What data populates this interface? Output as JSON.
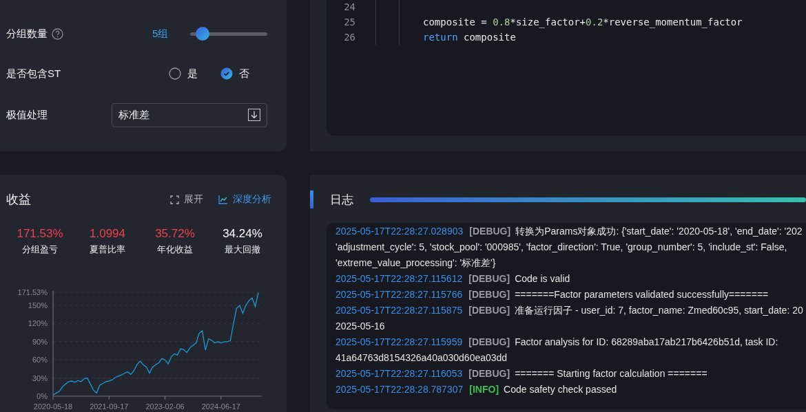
{
  "settings": {
    "group_count": {
      "label": "分组数量",
      "value": "5组",
      "level": 0.1
    },
    "include_st": {
      "label": "是否包含ST",
      "options": [
        {
          "label": "是",
          "selected": false
        },
        {
          "label": "否",
          "selected": true
        }
      ]
    },
    "extreme_value": {
      "label": "极值处理",
      "value": "标准差"
    }
  },
  "code": {
    "lines": [
      {
        "number": "24"
      },
      {
        "number": "25",
        "tokens": [
          {
            "text": "composite = ",
            "kind": "plain"
          },
          {
            "text": "0.8",
            "kind": "number"
          },
          {
            "text": "*size_factor+",
            "kind": "plain"
          },
          {
            "text": "0.2",
            "kind": "number"
          },
          {
            "text": "*reverse_momentum_factor",
            "kind": "plain"
          }
        ]
      },
      {
        "number": "26",
        "tokens": [
          {
            "text": "return",
            "kind": "keyword"
          },
          {
            "text": " composite",
            "kind": "plain"
          }
        ]
      }
    ]
  },
  "returns": {
    "title": "收益",
    "actions": [
      {
        "label": "展开",
        "kind": "expand"
      },
      {
        "label": "深度分析",
        "kind": "analysis"
      }
    ],
    "metrics": [
      {
        "value": "171.53%",
        "label": "分组盈亏",
        "color": "#f0424c"
      },
      {
        "value": "1.0994",
        "label": "夏普比率",
        "color": "#f0424c"
      },
      {
        "value": "35.72%",
        "label": "年化收益",
        "color": "#f0424c"
      },
      {
        "value": "34.24%",
        "label": "最大回撤",
        "color": "#ffffff"
      }
    ],
    "chart_data": {
      "type": "line",
      "grid": true,
      "categories": [
        "2020-05-18",
        null,
        null,
        null,
        null,
        null,
        null,
        null,
        null,
        null,
        null,
        null,
        null,
        null,
        null,
        null,
        null,
        null,
        "2021-09-17",
        null,
        null,
        null,
        null,
        null,
        null,
        null,
        null,
        null,
        null,
        null,
        null,
        null,
        null,
        null,
        null,
        null,
        "2023-02-06",
        null,
        null,
        null,
        null,
        null,
        null,
        null,
        null,
        null,
        null,
        null,
        null,
        null,
        null,
        null,
        null,
        null,
        "2024-06-17",
        null,
        null,
        null,
        null,
        null,
        null,
        null,
        null,
        null,
        null,
        null,
        null
      ],
      "ylim": [
        0,
        171.53
      ],
      "yticks": [
        {
          "value": 0,
          "label": "0%"
        },
        {
          "value": 30,
          "label": "30%"
        },
        {
          "value": 60,
          "label": "60%"
        },
        {
          "value": 90,
          "label": "90%"
        },
        {
          "value": 120,
          "label": "120%"
        },
        {
          "value": 150,
          "label": "150%"
        },
        {
          "value": 171.53,
          "label": "171.53%"
        }
      ],
      "series": [
        {
          "color": "#1a9ad6",
          "values": [
            2,
            5,
            8,
            15,
            20,
            24,
            25,
            23,
            26,
            24,
            29,
            30,
            20,
            10,
            5,
            18,
            21,
            24,
            25,
            27,
            31,
            33,
            35,
            38,
            40,
            36,
            42,
            52,
            58,
            52,
            48,
            38,
            48,
            52,
            55,
            62,
            60,
            53,
            65,
            70,
            68,
            78,
            77,
            72,
            80,
            84,
            88,
            104,
            108,
            76,
            95,
            92,
            88,
            90,
            88,
            90,
            90,
            92,
            120,
            145,
            150,
            137,
            150,
            158,
            162,
            148,
            171
          ]
        }
      ]
    }
  },
  "log": {
    "title": "日志",
    "entries": [
      {
        "time": "2025-05-17T22:28:27.028903",
        "level": "[DEBUG]",
        "kind": "debug",
        "lines": [
          "转换为Params对象成功: {'start_date': '2020-05-18', 'end_date': '202",
          "'adjustment_cycle': 5, 'stock_pool': '000985', 'factor_direction': True, 'group_number': 5, 'include_st': False,",
          "'extreme_value_processing': '标准差'}"
        ]
      },
      {
        "time": "2025-05-17T22:28:27.115612",
        "level": "[DEBUG]",
        "kind": "debug",
        "lines": [
          "Code is valid"
        ]
      },
      {
        "time": "2025-05-17T22:28:27.115766",
        "level": "[DEBUG]",
        "kind": "debug",
        "lines": [
          "=======Factor parameters validated successfully======="
        ]
      },
      {
        "time": "2025-05-17T22:28:27.115875",
        "level": "[DEBUG]",
        "kind": "debug",
        "lines": [
          "准备运行因子 - user_id: 7, factor_name: Zmed60c95, start_date: 20",
          "2025-05-16"
        ]
      },
      {
        "time": "2025-05-17T22:28:27.115959",
        "level": "[DEBUG]",
        "kind": "debug",
        "lines": [
          "Factor analysis for ID: 68289aba17ab217b6426b51d, task ID:",
          "41a64763d8154326a40a030d60ea03dd"
        ]
      },
      {
        "time": "2025-05-17T22:28:27.116053",
        "level": "[DEBUG]",
        "kind": "debug",
        "lines": [
          "======= Starting factor calculation ======="
        ]
      },
      {
        "time": "2025-05-17T22:28:28.787307",
        "level": "[INFO]",
        "kind": "info",
        "lines": [
          "Code safety check passed"
        ]
      }
    ]
  }
}
